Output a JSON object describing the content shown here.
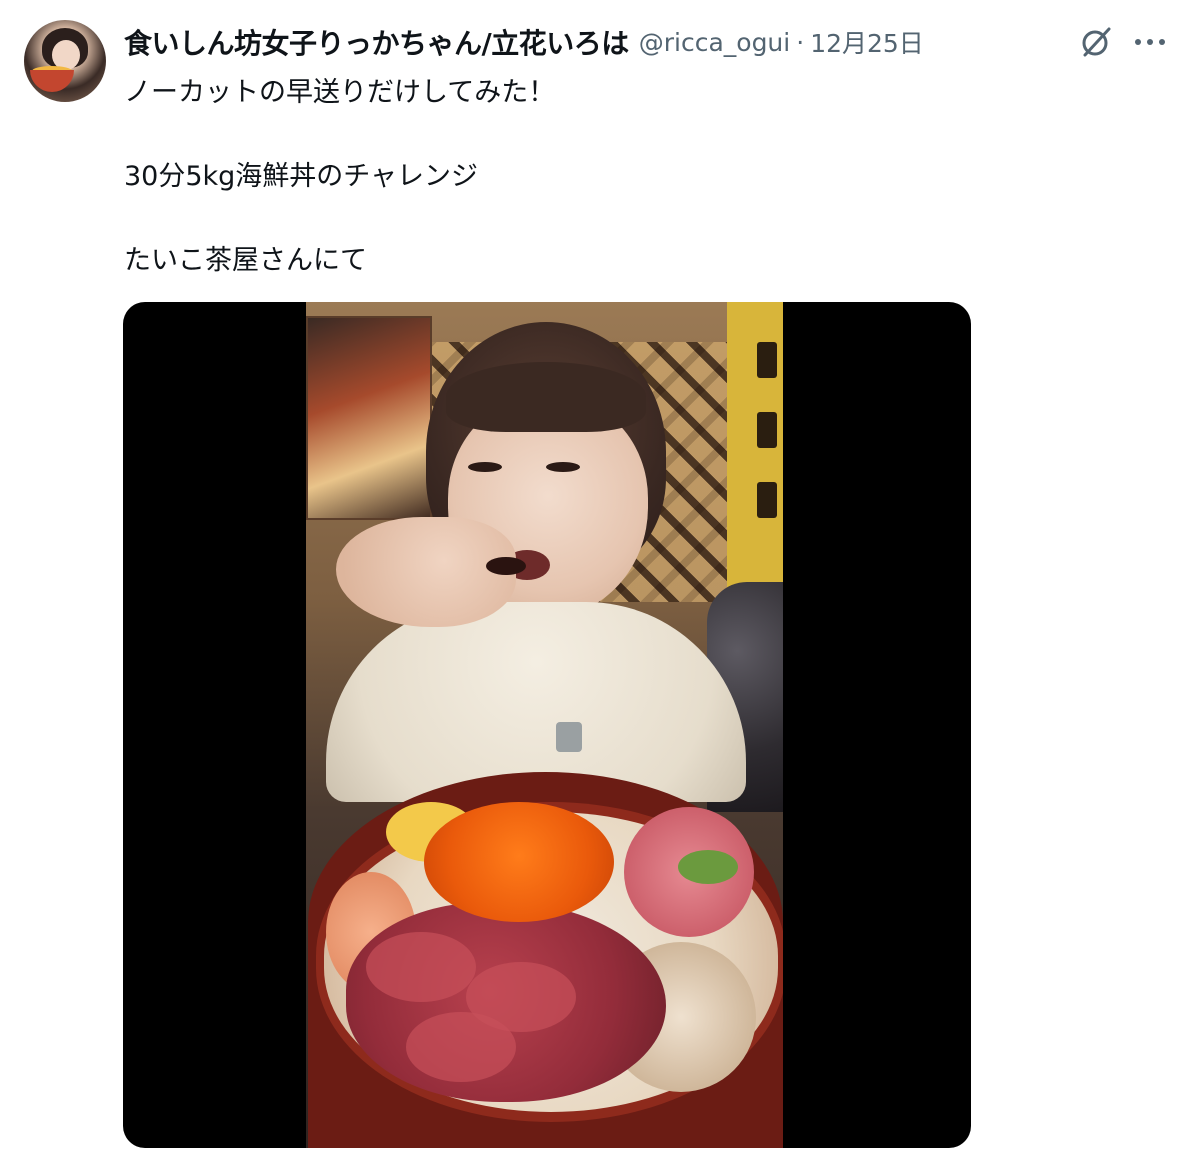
{
  "tweet": {
    "display_name": "食いしん坊女子りっかちゃん/立花いろは",
    "handle": "@ricca_ogui",
    "separator": "·",
    "date": "12月25日",
    "text_lines": [
      "ノーカットの早送りだけしてみた！",
      "30分5kg海鮮丼のチャレンジ",
      "たいこ茶屋さんにて"
    ]
  },
  "icons": {
    "grok": "grok-icon",
    "more": "more-icon",
    "avatar": "avatar"
  },
  "colors": {
    "text_primary": "#0f1419",
    "text_secondary": "#536471",
    "video_background": "#000000"
  }
}
